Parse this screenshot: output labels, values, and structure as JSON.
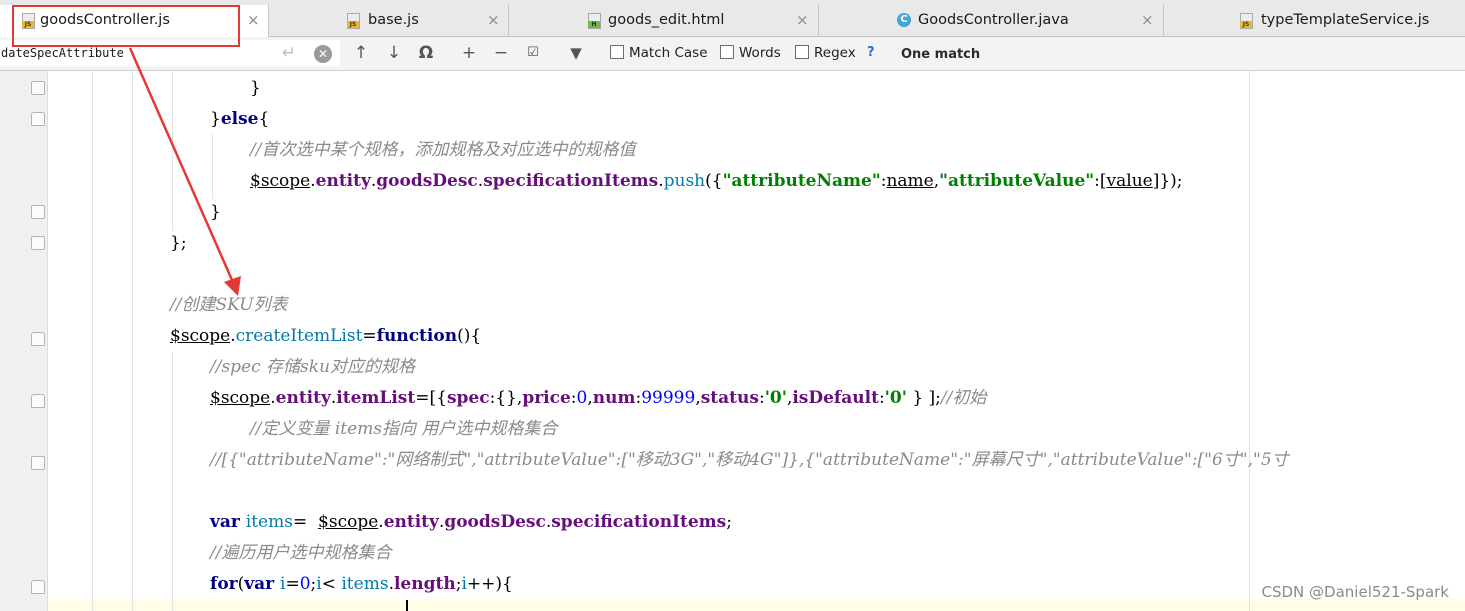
{
  "tabs": [
    {
      "label": "goodsController.js",
      "icon": "js-file-icon",
      "active": true
    },
    {
      "label": "base.js",
      "icon": "js-file-icon",
      "active": false
    },
    {
      "label": "goods_edit.html",
      "icon": "html-file-icon",
      "active": false
    },
    {
      "label": "GoodsController.java",
      "icon": "java-class-icon",
      "active": false
    },
    {
      "label": "typeTemplateService.js",
      "icon": "js-file-icon",
      "active": false
    }
  ],
  "tab_close_glyph": "×",
  "find_bar": {
    "query": "dateSpecAttribute",
    "options": [
      {
        "label": "Match Case",
        "checked": false
      },
      {
        "label": "Words",
        "checked": false
      },
      {
        "label": "Regex",
        "checked": false
      }
    ],
    "help": "?",
    "status": "One match"
  },
  "code_lines": [
    [
      {
        "c": "plain",
        "t": "}"
      }
    ],
    [
      {
        "c": "plain",
        "t": "}"
      },
      {
        "c": "kw",
        "t": "else"
      },
      {
        "c": "plain",
        "t": "{"
      }
    ],
    [
      {
        "c": "cmt",
        "t": "//首次选中某个规格，添加规格及对应选中的规格值"
      }
    ],
    [
      {
        "c": "scopev",
        "t": "$scope"
      },
      {
        "c": "plain",
        "t": "."
      },
      {
        "c": "prop",
        "t": "entity"
      },
      {
        "c": "plain",
        "t": "."
      },
      {
        "c": "prop",
        "t": "goodsDesc"
      },
      {
        "c": "plain",
        "t": "."
      },
      {
        "c": "prop",
        "t": "specificationItems"
      },
      {
        "c": "plain",
        "t": "."
      },
      {
        "c": "fn",
        "t": "push"
      },
      {
        "c": "plain",
        "t": "({"
      },
      {
        "c": "str",
        "t": "\"attributeName\""
      },
      {
        "c": "plain",
        "t": ":"
      },
      {
        "c": "paramv",
        "t": "name"
      },
      {
        "c": "plain",
        "t": ","
      },
      {
        "c": "str",
        "t": "\"attributeValue\""
      },
      {
        "c": "plain",
        "t": ":["
      },
      {
        "c": "paramv",
        "t": "value"
      },
      {
        "c": "plain",
        "t": "]});"
      }
    ],
    [
      {
        "c": "plain",
        "t": "}"
      }
    ],
    [
      {
        "c": "plain",
        "t": "};"
      }
    ],
    [],
    [
      {
        "c": "cmt",
        "t": "//创建SKU列表"
      }
    ],
    [
      {
        "c": "scopev",
        "t": "$scope"
      },
      {
        "c": "plain",
        "t": "."
      },
      {
        "c": "fn",
        "t": "createItemList"
      },
      {
        "c": "plain",
        "t": "="
      },
      {
        "c": "kw",
        "t": "function"
      },
      {
        "c": "plain",
        "t": "(){"
      }
    ],
    [
      {
        "c": "cmt",
        "t": "//spec 存储sku对应的规格"
      }
    ],
    [
      {
        "c": "scopev",
        "t": "$scope"
      },
      {
        "c": "plain",
        "t": "."
      },
      {
        "c": "prop",
        "t": "entity"
      },
      {
        "c": "plain",
        "t": "."
      },
      {
        "c": "prop",
        "t": "itemList"
      },
      {
        "c": "plain",
        "t": "=[{"
      },
      {
        "c": "prop",
        "t": "spec"
      },
      {
        "c": "plain",
        "t": ":{},"
      },
      {
        "c": "prop",
        "t": "price"
      },
      {
        "c": "plain",
        "t": ":"
      },
      {
        "c": "num",
        "t": "0"
      },
      {
        "c": "plain",
        "t": ","
      },
      {
        "c": "prop",
        "t": "num"
      },
      {
        "c": "plain",
        "t": ":"
      },
      {
        "c": "num",
        "t": "99999"
      },
      {
        "c": "plain",
        "t": ","
      },
      {
        "c": "prop",
        "t": "status"
      },
      {
        "c": "plain",
        "t": ":"
      },
      {
        "c": "str",
        "t": "'0'"
      },
      {
        "c": "plain",
        "t": ","
      },
      {
        "c": "prop",
        "t": "isDefault"
      },
      {
        "c": "plain",
        "t": ":"
      },
      {
        "c": "str",
        "t": "'0'"
      },
      {
        "c": "plain",
        "t": " } ];"
      },
      {
        "c": "cmt",
        "t": "//初始"
      }
    ],
    [
      {
        "c": "cmt",
        "t": "//定义变量 items指向 用户选中规格集合"
      }
    ],
    [
      {
        "c": "cmt",
        "t": "//[{\"attributeName\":\"网络制式\",\"attributeValue\":[\"移动3G\",\"移动4G\"]},{\"attributeName\":\"屏幕尺寸\",\"attributeValue\":[\"6寸\",\"5寸"
      }
    ],
    [],
    [
      {
        "c": "kw",
        "t": "var "
      },
      {
        "c": "fn",
        "t": "items"
      },
      {
        "c": "plain",
        "t": "=  "
      },
      {
        "c": "scopev",
        "t": "$scope"
      },
      {
        "c": "plain",
        "t": "."
      },
      {
        "c": "prop",
        "t": "entity"
      },
      {
        "c": "plain",
        "t": "."
      },
      {
        "c": "prop",
        "t": "goodsDesc"
      },
      {
        "c": "plain",
        "t": "."
      },
      {
        "c": "prop",
        "t": "specificationItems"
      },
      {
        "c": "plain",
        "t": ";"
      }
    ],
    [
      {
        "c": "cmt",
        "t": "//遍历用户选中规格集合"
      }
    ],
    [
      {
        "c": "kw",
        "t": "for"
      },
      {
        "c": "plain",
        "t": "("
      },
      {
        "c": "kw",
        "t": "var "
      },
      {
        "c": "fn",
        "t": "i"
      },
      {
        "c": "plain",
        "t": "="
      },
      {
        "c": "num",
        "t": "0"
      },
      {
        "c": "plain",
        "t": ";"
      },
      {
        "c": "fn",
        "t": "i"
      },
      {
        "c": "plain",
        "t": "< "
      },
      {
        "c": "fn",
        "t": "items"
      },
      {
        "c": "plain",
        "t": "."
      },
      {
        "c": "prop",
        "t": "length"
      },
      {
        "c": "plain",
        "t": ";"
      },
      {
        "c": "fn",
        "t": "i"
      },
      {
        "c": "plain",
        "t": "++){"
      }
    ]
  ],
  "watermark": "CSDN @Daniel521-Spark"
}
